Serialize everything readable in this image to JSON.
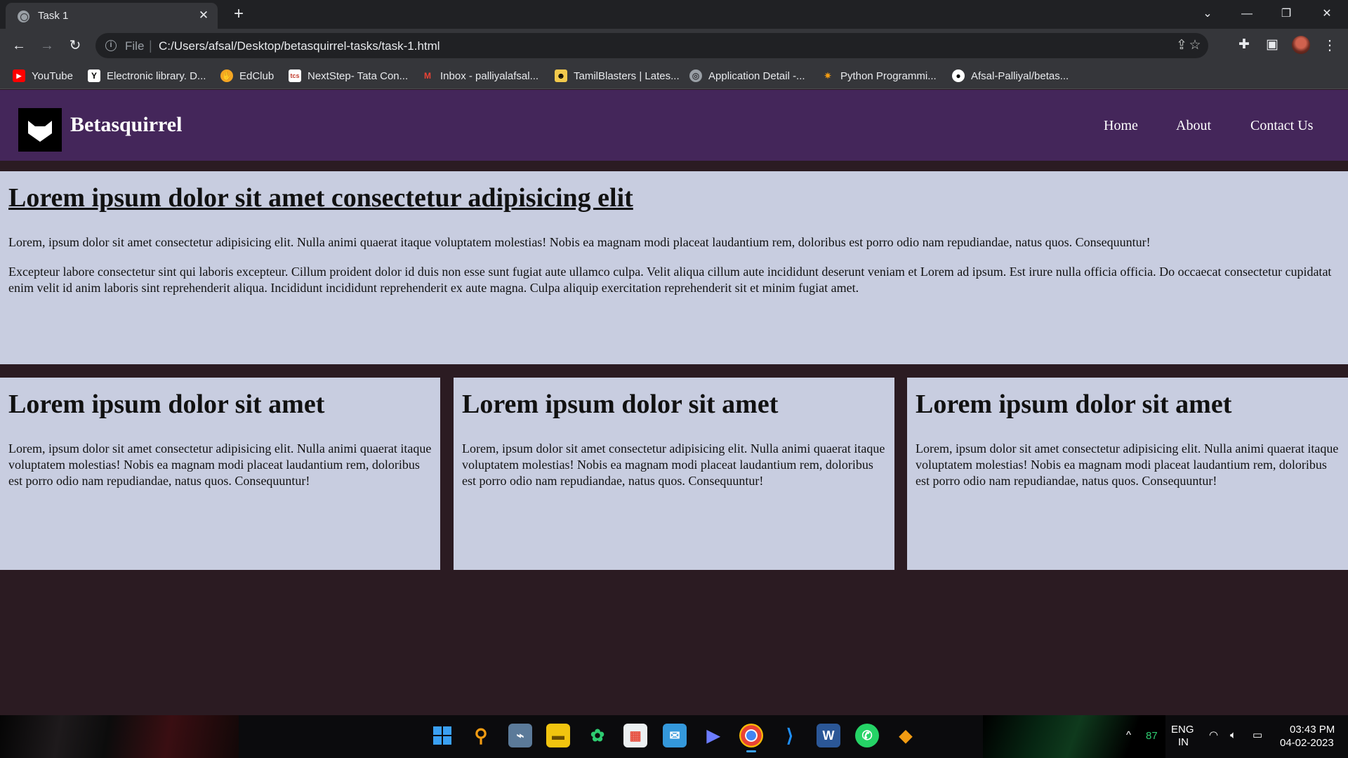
{
  "browser": {
    "tab_title": "Task 1",
    "scheme_label": "File",
    "url": "C:/Users/afsal/Desktop/betasquirrel-tasks/task-1.html",
    "bookmarks": [
      {
        "label": "YouTube",
        "icon": "youtube-icon",
        "color": "#ff0000"
      },
      {
        "label": "Electronic library. D...",
        "icon": "library-icon",
        "color": "#ffffff"
      },
      {
        "label": "EdClub",
        "icon": "edclub-icon",
        "color": "#f5a623"
      },
      {
        "label": "NextStep- Tata Con...",
        "icon": "tcs-icon",
        "color": "#ffffff"
      },
      {
        "label": "Inbox - palliyalafsal...",
        "icon": "gmail-icon",
        "color": "#ea4335"
      },
      {
        "label": "TamilBlasters | Lates...",
        "icon": "tamilblasters-icon",
        "color": "#f2c94c"
      },
      {
        "label": "Application Detail -...",
        "icon": "globe-icon",
        "color": "#9aa0a6"
      },
      {
        "label": "Python Programmi...",
        "icon": "python-icon",
        "color": "#f39c12"
      },
      {
        "label": "Afsal-Palliyal/betas...",
        "icon": "github-icon",
        "color": "#ffffff"
      }
    ]
  },
  "site": {
    "brand": "Betasquirrel",
    "nav": [
      "Home",
      "About",
      "Contact Us"
    ],
    "hero": {
      "title": "Lorem ipsum dolor sit amet consectetur adipisicing elit",
      "p1": "Lorem, ipsum dolor sit amet consectetur adipisicing elit. Nulla animi quaerat itaque voluptatem molestias! Nobis ea magnam modi placeat laudantium rem, doloribus est porro odio nam repudiandae, natus quos. Consequuntur!",
      "p2": "Excepteur labore consectetur sint qui laboris excepteur. Cillum proident dolor id duis non esse sunt fugiat aute ullamco culpa. Velit aliqua cillum aute incididunt deserunt veniam et Lorem ad ipsum. Est irure nulla officia officia. Do occaecat consectetur cupidatat enim velit id anim laboris sint reprehenderit aliqua. Incididunt incididunt reprehenderit ex aute magna. Culpa aliquip exercitation reprehenderit sit et minim fugiat amet."
    },
    "cards": [
      {
        "title": "Lorem ipsum dolor sit amet",
        "text": "Lorem, ipsum dolor sit amet consectetur adipisicing elit. Nulla animi quaerat itaque voluptatem molestias! Nobis ea magnam modi placeat laudantium rem, doloribus est porro odio nam repudiandae, natus quos. Consequuntur!"
      },
      {
        "title": "Lorem ipsum dolor sit amet",
        "text": "Lorem, ipsum dolor sit amet consectetur adipisicing elit. Nulla animi quaerat itaque voluptatem molestias! Nobis ea magnam modi placeat laudantium rem, doloribus est porro odio nam repudiandae, natus quos. Consequuntur!"
      },
      {
        "title": "Lorem ipsum dolor sit amet",
        "text": "Lorem, ipsum dolor sit amet consectetur adipisicing elit. Nulla animi quaerat itaque voluptatem molestias! Nobis ea magnam modi placeat laudantium rem, doloribus est porro odio nam repudiandae, natus quos. Consequuntur!"
      }
    ]
  },
  "taskbar": {
    "battery_level": "87",
    "lang_line1": "ENG",
    "lang_line2": "IN",
    "time": "03:43 PM",
    "date": "04-02-2023"
  },
  "colors": {
    "nav_bg": "#44265a",
    "content_bg": "#c8cde0",
    "page_bg": "#2b1b22"
  }
}
